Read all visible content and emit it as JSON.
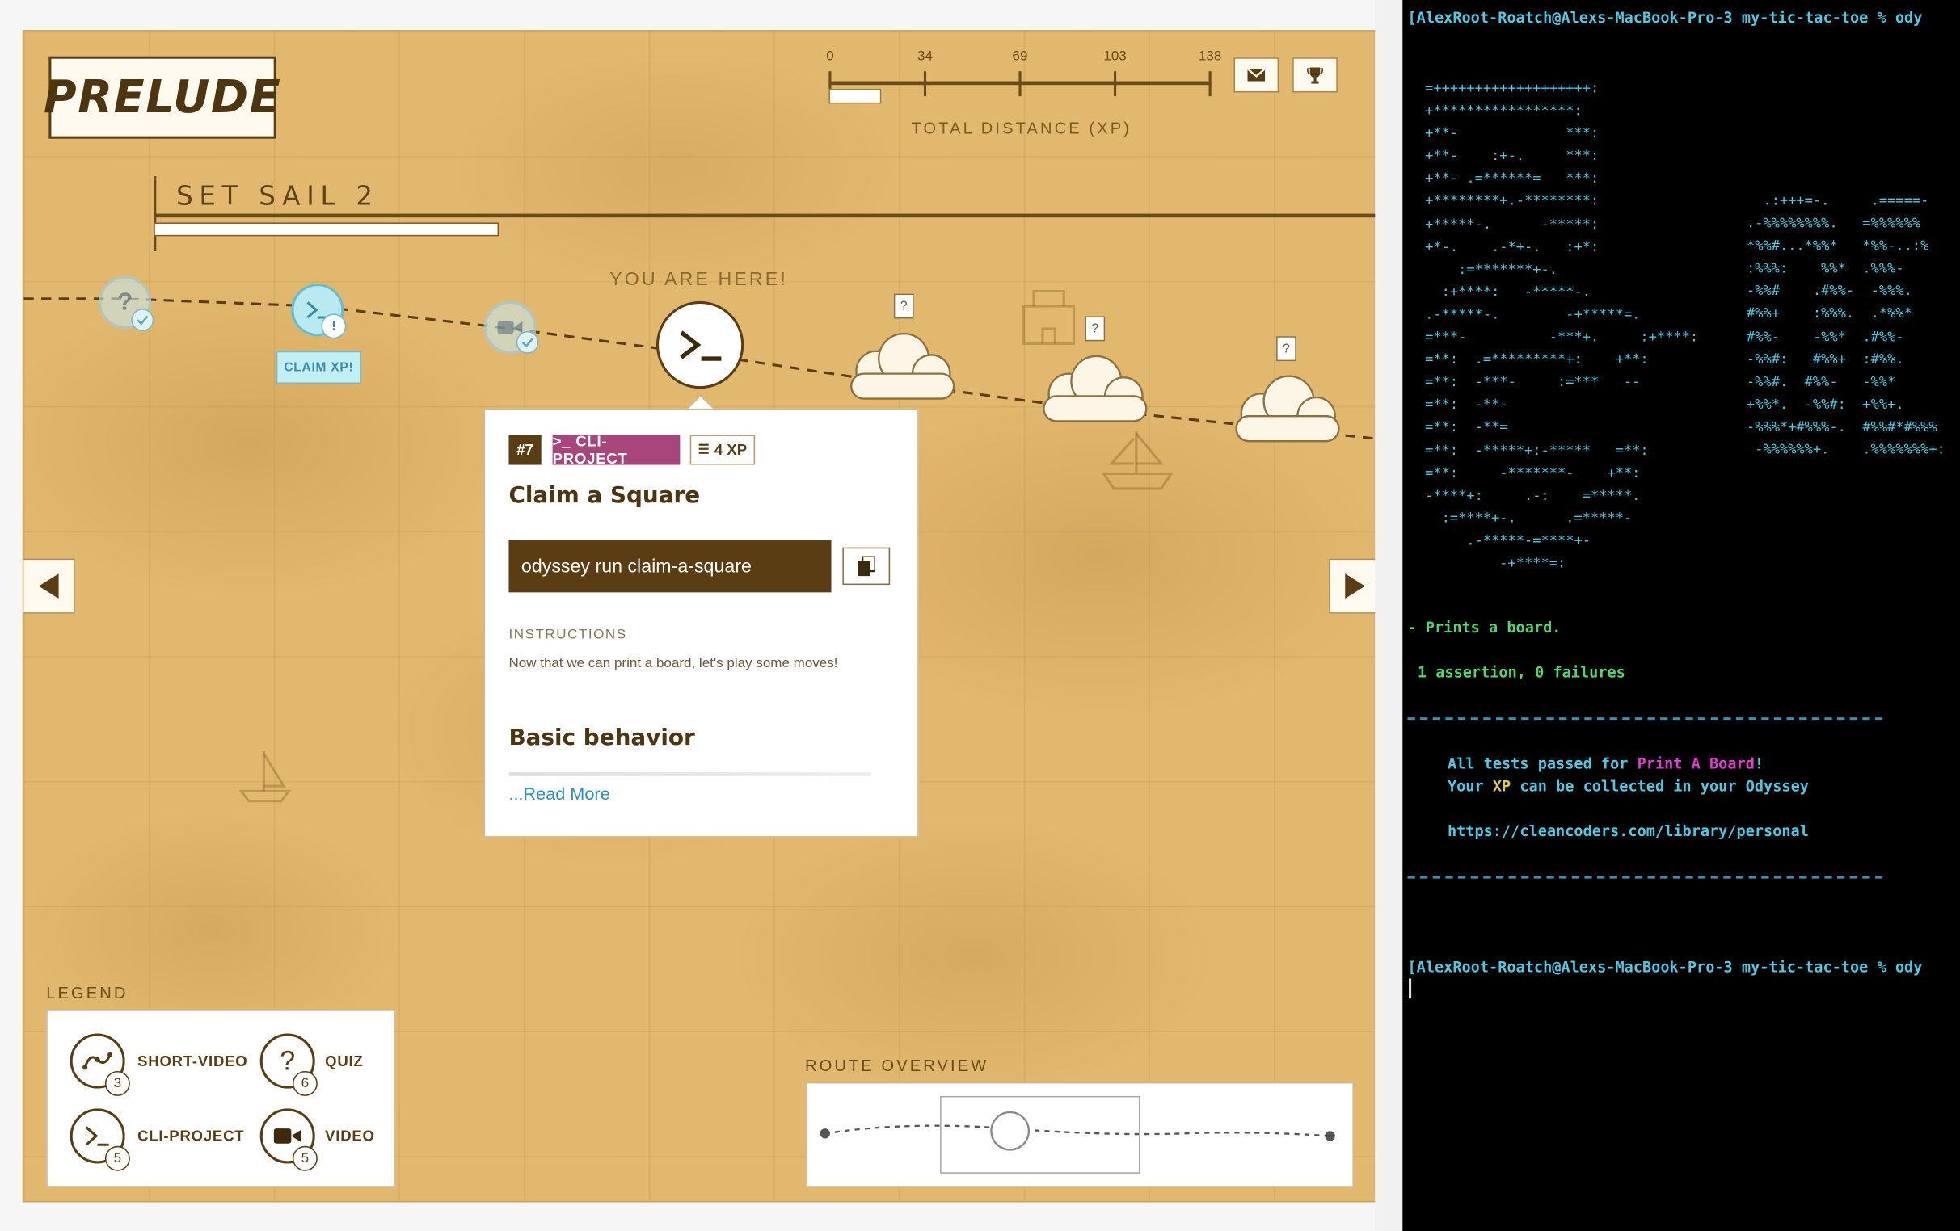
{
  "brand": {
    "logo": "PRELUDE"
  },
  "section": {
    "title": "SET SAIL 2",
    "progress": 0.25
  },
  "xp_track": {
    "ticks": [
      "0",
      "34",
      "69",
      "103",
      "138"
    ],
    "caption": "TOTAL DISTANCE (XP)",
    "progress": 0.13
  },
  "toolbar": {
    "mail_icon": "envelope-icon",
    "trophy_icon": "trophy-icon"
  },
  "route": {
    "claim_label": "CLAIM XP!",
    "you_are_here": "YOU ARE HERE!",
    "cloud_marker": "?"
  },
  "card": {
    "number": "#7",
    "type": ">_ CLI-PROJECT",
    "xp": "4 XP",
    "title": "Claim a Square",
    "command": "odyssey run claim-a-square",
    "instructions_heading": "INSTRUCTIONS",
    "instructions_text": "Now that we can print a board, let's play some moves!",
    "subheading": "Basic behavior",
    "read_more": "...Read More"
  },
  "legend": {
    "heading": "LEGEND",
    "items": [
      {
        "label": "SHORT-VIDEO",
        "count": "3",
        "icon": "short-video-icon"
      },
      {
        "label": "QUIZ",
        "count": "6",
        "icon": "quiz-icon"
      },
      {
        "label": "CLI-PROJECT",
        "count": "5",
        "icon": "terminal-icon"
      },
      {
        "label": "VIDEO",
        "count": "5",
        "icon": "video-camera-icon"
      }
    ]
  },
  "route_overview": {
    "heading": "ROUTE OVERVIEW"
  },
  "terminal": {
    "prompt_top": "[AlexRoot-Roatch@Alexs-MacBook-Pro-3 my-tic-tac-toe % ody",
    "ascii_left": "=+++++++++++++++++++:\n+*****************:\n+**-             ***:\n+**-    :+-.     ***:\n+**- .=******=   ***:\n+********+.-********:\n+*****-.      -*****:\n+*-.    .-*+-.   :+*:\n    :=*******+-.\n  :+****:   -*****-.\n.-*****-.        -+*****=.\n=***-          -***+.     :+****:\n=**:  .=*********+:    +**:\n=**:  -***-     :=***   --\n=**:  -**-\n=**:  -**=\n=**:  -*****+:-*****   =**:\n=**:     -*******-    +**:\n-****+:     .-:    =*****.\n  :=****+-.      .=*****-\n     .-*****-=****+-\n         -+****=:",
    "ascii_right": "    .:+++=-.     .=====-\n  .-%%%%%%%%.   =%%%%%%\n  *%%#...*%%*   *%%-..:%\n  :%%%:    %%*  .%%%-\n  -%%#    .#%%-  -%%%.\n  #%%+    :%%%.  .*%%*\n  #%%-    -%%*  .#%%-\n  -%%#:   #%%+  :#%%.\n  -%%#.  #%%-   -%%*\n  +%%*.  -%%#:  +%%+.\n  -%%%*+#%%%-.  #%%#*#%%%\n   -%%%%%%+.    .%%%%%%%+:",
    "result_line": "- Prints a board.",
    "assertions": "1 assertion, 0 failures",
    "all_tests_prefix": "All tests passed for ",
    "all_tests_name": "Print A Board",
    "all_tests_suffix": "!",
    "xp_line_prefix": "Your ",
    "xp_word": "XP",
    "xp_line_suffix": " can be collected in your Odyssey",
    "url": "https://cleancoders.com/library/personal",
    "prompt_bottom": "[AlexRoot-Roatch@Alexs-MacBook-Pro-3 my-tic-tac-toe % ody"
  }
}
